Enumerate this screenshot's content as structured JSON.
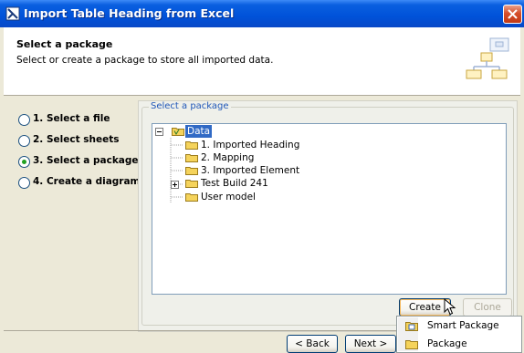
{
  "window": {
    "title": "Import Table Heading from Excel"
  },
  "header": {
    "title": "Select a package",
    "description": "Select or create a package to store all imported data."
  },
  "steps": [
    {
      "label": "1. Select a file",
      "checked": false
    },
    {
      "label": "2. Select sheets",
      "checked": false
    },
    {
      "label": "3. Select a package",
      "checked": true
    },
    {
      "label": "4. Create a diagram",
      "checked": false
    }
  ],
  "group": {
    "label": "Select a package"
  },
  "tree": {
    "root": {
      "label": "Data",
      "expanded": true,
      "selected": true
    },
    "children": [
      {
        "label": "1. Imported Heading",
        "expandable": false
      },
      {
        "label": "2. Mapping",
        "expandable": false
      },
      {
        "label": "3. Imported Element",
        "expandable": false
      },
      {
        "label": "Test Build 241",
        "expandable": true
      },
      {
        "label": "User model",
        "expandable": false
      }
    ]
  },
  "buttons": {
    "create": "Create",
    "clone": "Clone",
    "back": "< Back",
    "next": "Next >"
  },
  "menu": {
    "items": [
      {
        "label": "Smart Package",
        "icon": "smart-package-icon"
      },
      {
        "label": "Package",
        "icon": "package-folder-icon"
      }
    ]
  },
  "colors": {
    "title_bar": "#0052d9",
    "selection": "#316ac5",
    "group_label": "#1f56b8",
    "folder": "#f5d35b"
  }
}
